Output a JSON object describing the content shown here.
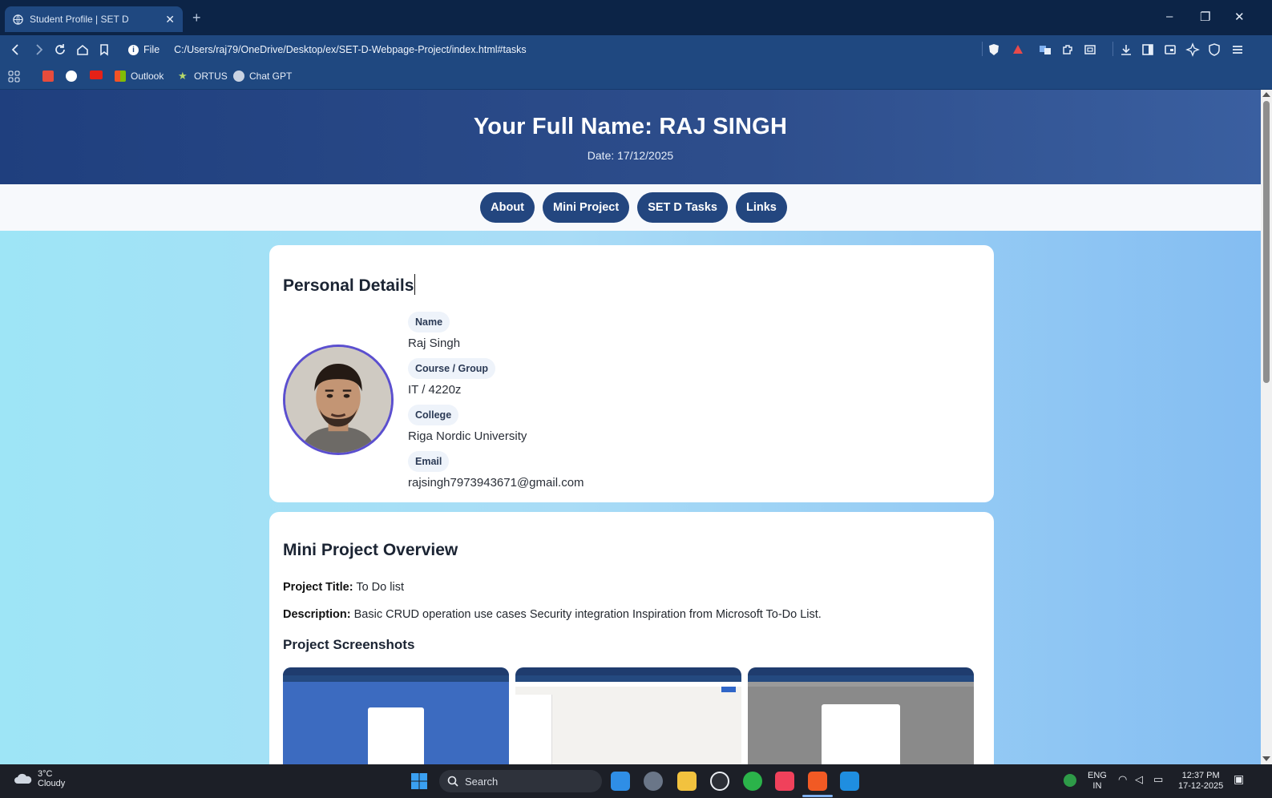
{
  "browser": {
    "tab_title": "Student Profile | SET D",
    "url_scheme": "File",
    "url": "C:/Users/raj79/OneDrive/Desktop/ex/SET-D-Webpage-Project/index.html#tasks",
    "bookmarks": [
      "Outlook",
      "ORTUS",
      "Chat GPT"
    ]
  },
  "header": {
    "title": "Your Full Name: RAJ SINGH",
    "date": "Date: 17/12/2025"
  },
  "nav": [
    "About",
    "Mini Project",
    "SET D Tasks",
    "Links"
  ],
  "personal": {
    "heading": "Personal Details",
    "fields": [
      {
        "label": "Name",
        "value": "Raj Singh"
      },
      {
        "label": "Course / Group",
        "value": "IT / 4220z"
      },
      {
        "label": "College",
        "value": "Riga Nordic University"
      },
      {
        "label": "Email",
        "value": "rajsingh7973943671@gmail.com"
      }
    ]
  },
  "project": {
    "heading": "Mini Project Overview",
    "title_label": "Project Title:",
    "title_value": "To Do list",
    "desc_label": "Description:",
    "desc_value": "Basic CRUD operation use cases Security integration Inspiration from Microsoft To-Do List.",
    "screens_heading": "Project Screenshots"
  },
  "taskbar": {
    "temp": "3°C",
    "weather": "Cloudy",
    "search": "Search",
    "lang": "ENG",
    "region": "IN",
    "time": "12:37 PM",
    "date": "17-12-2025"
  }
}
